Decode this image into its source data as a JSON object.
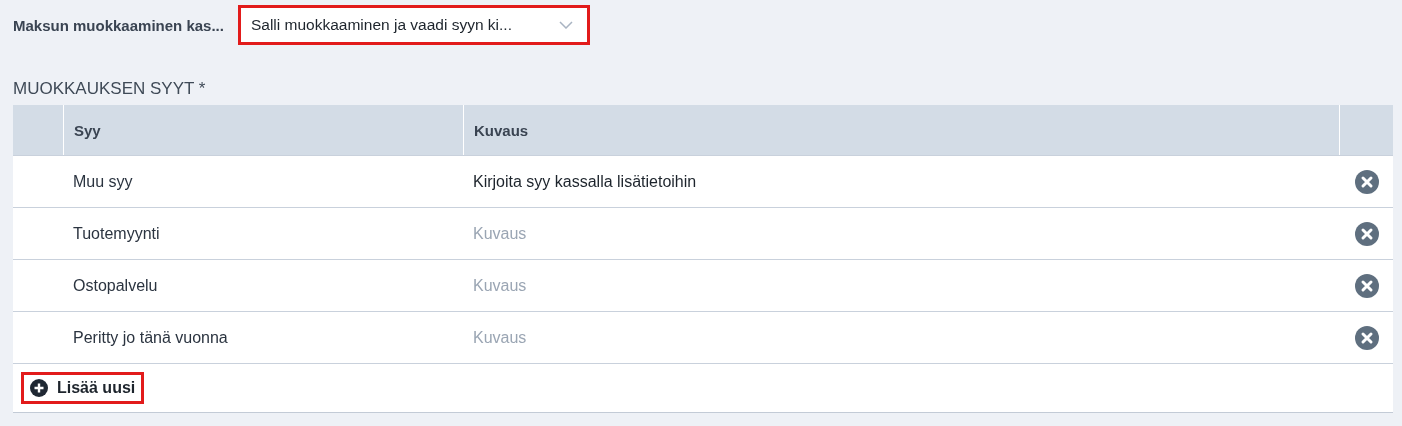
{
  "setting": {
    "label": "Maksun muokkaaminen kas...",
    "select": {
      "value": "Salli muokkaaminen ja vaadi syyn ki...",
      "highlighted": true
    }
  },
  "section_title": "MUOKKAUKSEN SYYT *",
  "table": {
    "columns": [
      "Syy",
      "Kuvaus"
    ],
    "rows": [
      {
        "reason": "Muu syy",
        "description": {
          "value": "Kirjoita syy kassalla lisätietoihin"
        }
      },
      {
        "reason": "Tuotemyynti",
        "description": {
          "placeholder": "Kuvaus"
        }
      },
      {
        "reason": "Ostopalvelu",
        "description": {
          "placeholder": "Kuvaus"
        }
      },
      {
        "reason": "Peritty jo tänä vuonna",
        "description": {
          "placeholder": "Kuvaus"
        }
      }
    ],
    "add_button": {
      "label": "Lisää uusi",
      "highlighted": true
    }
  }
}
